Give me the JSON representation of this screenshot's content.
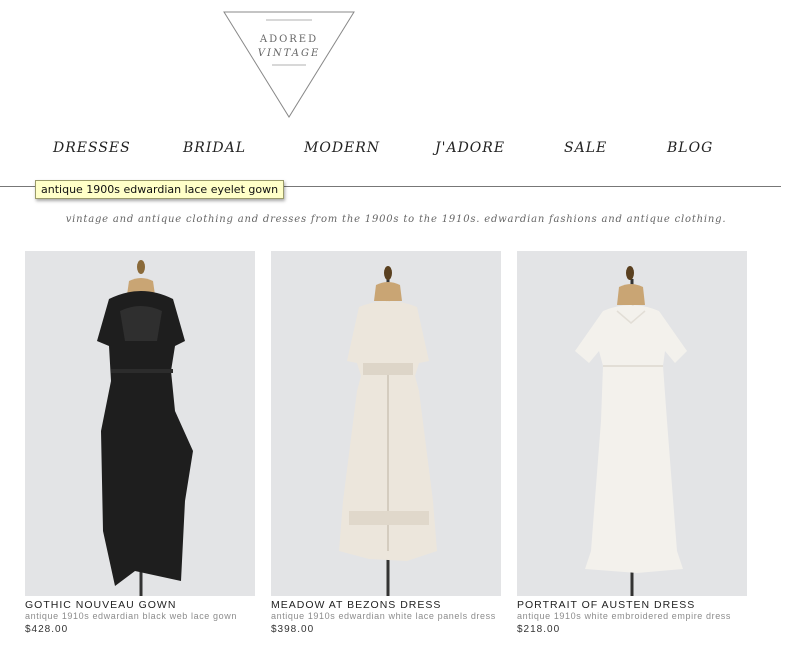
{
  "brand": {
    "line1": "ADORED",
    "line2": "VINTAGE"
  },
  "nav": {
    "items": [
      {
        "label": "DRESSES"
      },
      {
        "label": "BRIDAL"
      },
      {
        "label": "MODERN"
      },
      {
        "label": "J'ADORE"
      },
      {
        "label": "SALE"
      },
      {
        "label": "BLOG"
      }
    ]
  },
  "tooltip": "antique 1900s edwardian lace eyelet gown",
  "tagline": "vintage and antique clothing and dresses from the 1900s to the 1910s. edwardian fashions and antique clothing.",
  "products": [
    {
      "name": "GOTHIC NOUVEAU GOWN",
      "desc": "antique 1910s edwardian black web lace gown",
      "price": "$428.00",
      "dress_color": "#1e1e1e"
    },
    {
      "name": "MEADOW AT BEZONS DRESS",
      "desc": "antique 1910s edwardian white lace panels dress",
      "price": "$398.00",
      "dress_color": "#ece6dc"
    },
    {
      "name": "PORTRAIT OF AUSTEN DRESS",
      "desc": "antique 1910s white embroidered empire dress",
      "price": "$218.00",
      "dress_color": "#f3f1ec"
    }
  ],
  "colors": {
    "background": "#ffffff",
    "photo_bg": "#e3e4e6",
    "tooltip_bg": "#ffffc8"
  }
}
